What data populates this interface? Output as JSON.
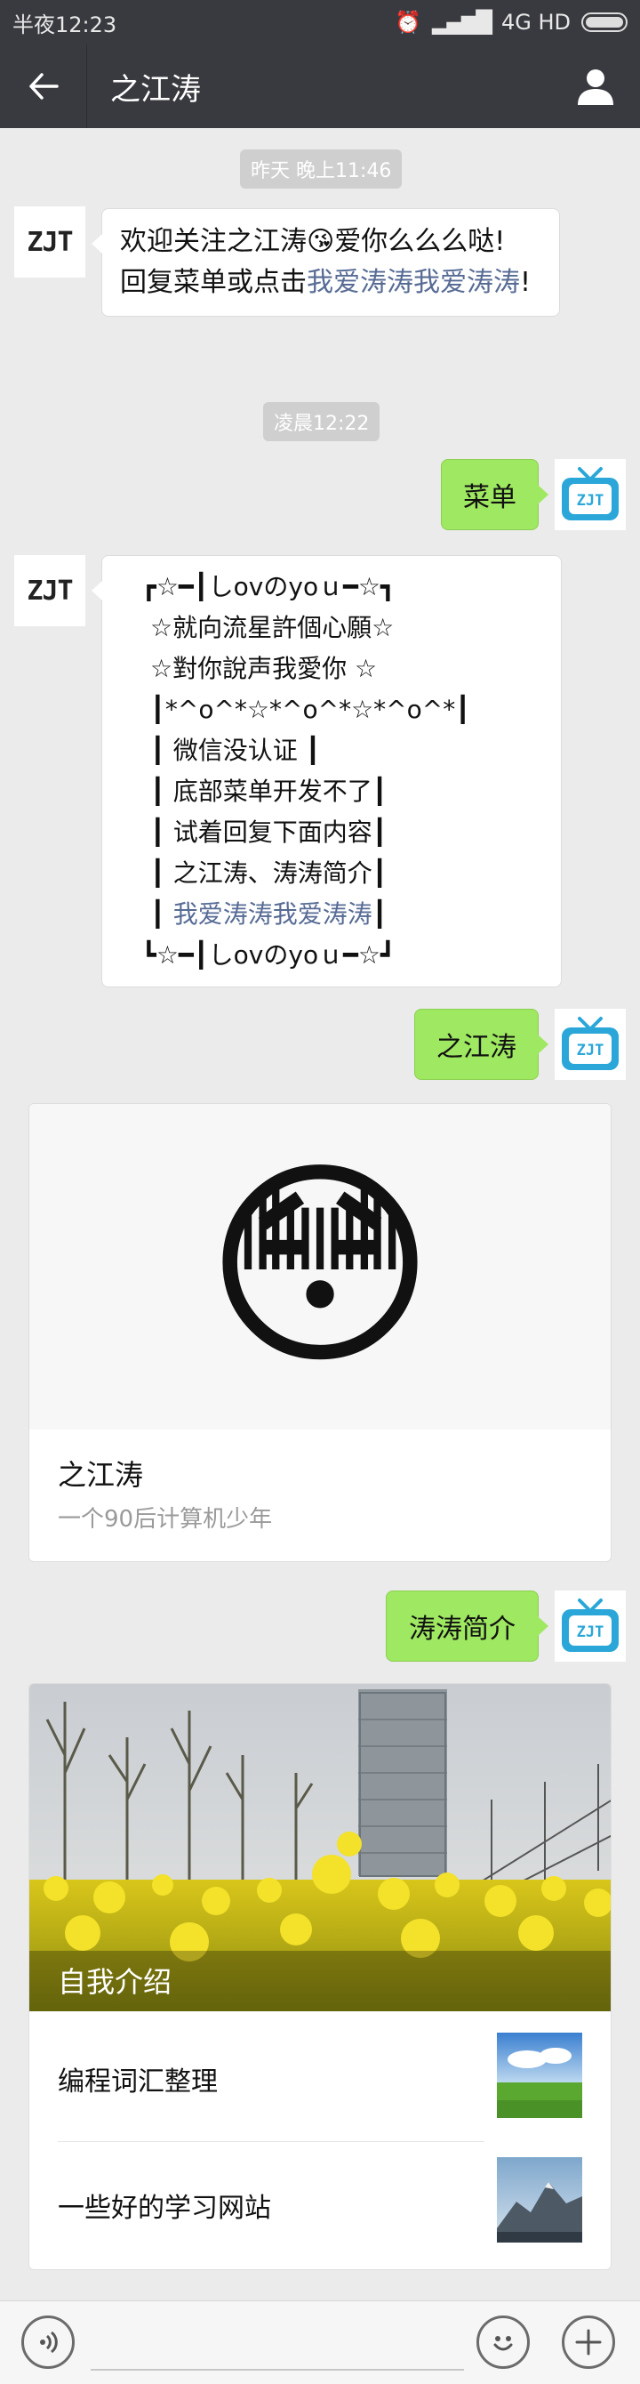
{
  "status_bar": {
    "time": "半夜12:23",
    "network": "4G HD"
  },
  "header": {
    "back_icon": "back-arrow-icon",
    "title": "之江涛",
    "profile_icon": "person-icon"
  },
  "messages": {
    "time_1": "昨天 晚上11:46",
    "welcome_a": "欢迎关注之江涛",
    "welcome_emoji": "😘",
    "welcome_b": "爱你么么么哒!",
    "welcome_c": "回复菜单或点击",
    "welcome_link": "我爱涛涛我爱涛涛",
    "welcome_d": "!",
    "time_2": "凌晨12:22",
    "user_1": "菜单",
    "menu_lines": [
      "┏☆━┃しovのyoｕ━☆┓",
      "☆就向流星許個心願☆",
      "☆對你說声我愛你 ☆",
      "┃*^o^*☆*^o^*☆*^o^*┃",
      "┃ 微信没认证 ┃",
      "┃ 底部菜单开发不了┃",
      "┃ 试着回复下面内容┃",
      "┃ 之江涛、涛涛简介┃"
    ],
    "menu_link_line": "我爱涛涛我爱涛涛",
    "menu_last": "┗☆━┃しovのyoｕ━☆┛",
    "user_2": "之江涛",
    "user_3": "涛涛简介"
  },
  "card_1": {
    "emoji": "😳",
    "title": "之江涛",
    "subtitle": "一个90后计算机少年"
  },
  "card_2": {
    "cover_title": "自我介绍",
    "items": [
      {
        "title": "编程词汇整理"
      },
      {
        "title": "一些好的学习网站"
      }
    ]
  },
  "avatars": {
    "official_label": "ZJT"
  },
  "colors": {
    "nav_bg": "#393a3f",
    "chat_bg": "#ebebeb",
    "user_bubble": "#9fe861",
    "link": "#576b95"
  }
}
